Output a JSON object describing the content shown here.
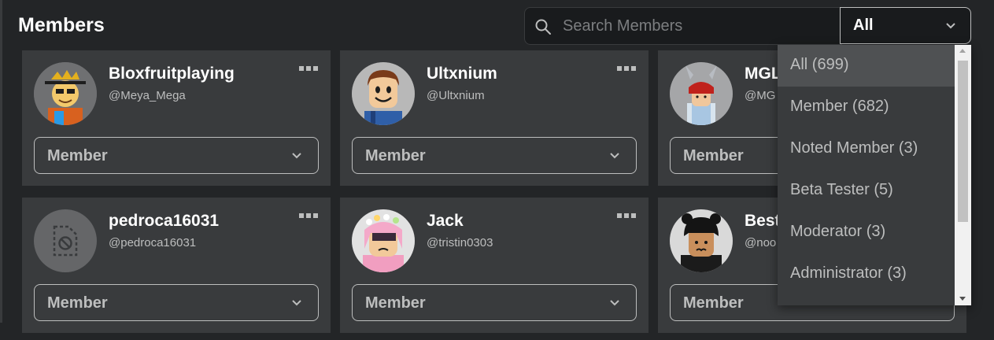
{
  "header": {
    "title": "Members",
    "search_placeholder": "Search Members",
    "filter_value": "All"
  },
  "members": [
    {
      "name": "Bloxfruitplaying",
      "handle": "@Meya_Mega",
      "role": "Member"
    },
    {
      "name": "Ultxnium",
      "handle": "@Ultxnium",
      "role": "Member"
    },
    {
      "name": "MGL",
      "handle": "@MG",
      "role": "Member"
    },
    {
      "name": "pedroca16031",
      "handle": "@pedroca16031",
      "role": "Member"
    },
    {
      "name": "Jack",
      "handle": "@tristin0303",
      "role": "Member"
    },
    {
      "name": "Best",
      "handle": "@noo",
      "role": "Member"
    }
  ],
  "role_filter_options": [
    {
      "label": "All (699)",
      "selected": true
    },
    {
      "label": "Member (682)",
      "selected": false
    },
    {
      "label": "Noted Member (3)",
      "selected": false
    },
    {
      "label": "Beta Tester (5)",
      "selected": false
    },
    {
      "label": "Moderator (3)",
      "selected": false
    },
    {
      "label": "Administrator (3)",
      "selected": false
    }
  ],
  "icons": {
    "search": "search-icon",
    "chevron": "chevron-down-icon",
    "more": "more-options-icon",
    "no_avatar": "image-unavailable-icon"
  },
  "colors": {
    "page_background": "#232527",
    "card_background": "#393b3d",
    "text_primary": "#ffffff",
    "text_secondary": "#bdbebe"
  }
}
